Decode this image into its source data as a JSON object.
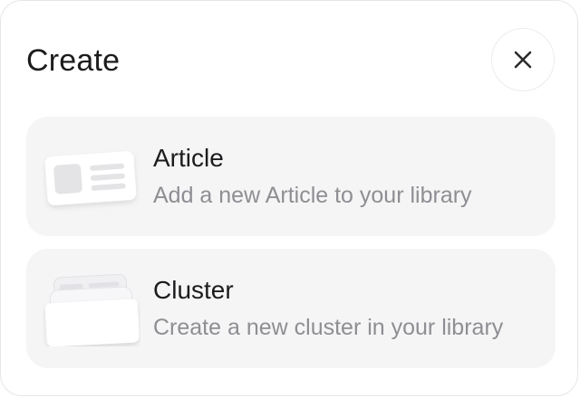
{
  "dialog": {
    "title": "Create",
    "close_icon": "close-icon"
  },
  "options": [
    {
      "title": "Article",
      "description": "Add a new Article to your library",
      "icon": "article-icon"
    },
    {
      "title": "Cluster",
      "description": "Create a new cluster in your library",
      "icon": "cluster-icon"
    }
  ],
  "colors": {
    "card_background": "#f5f5f6",
    "title_text": "#1c1c1e",
    "description_text": "#8e8e93"
  }
}
